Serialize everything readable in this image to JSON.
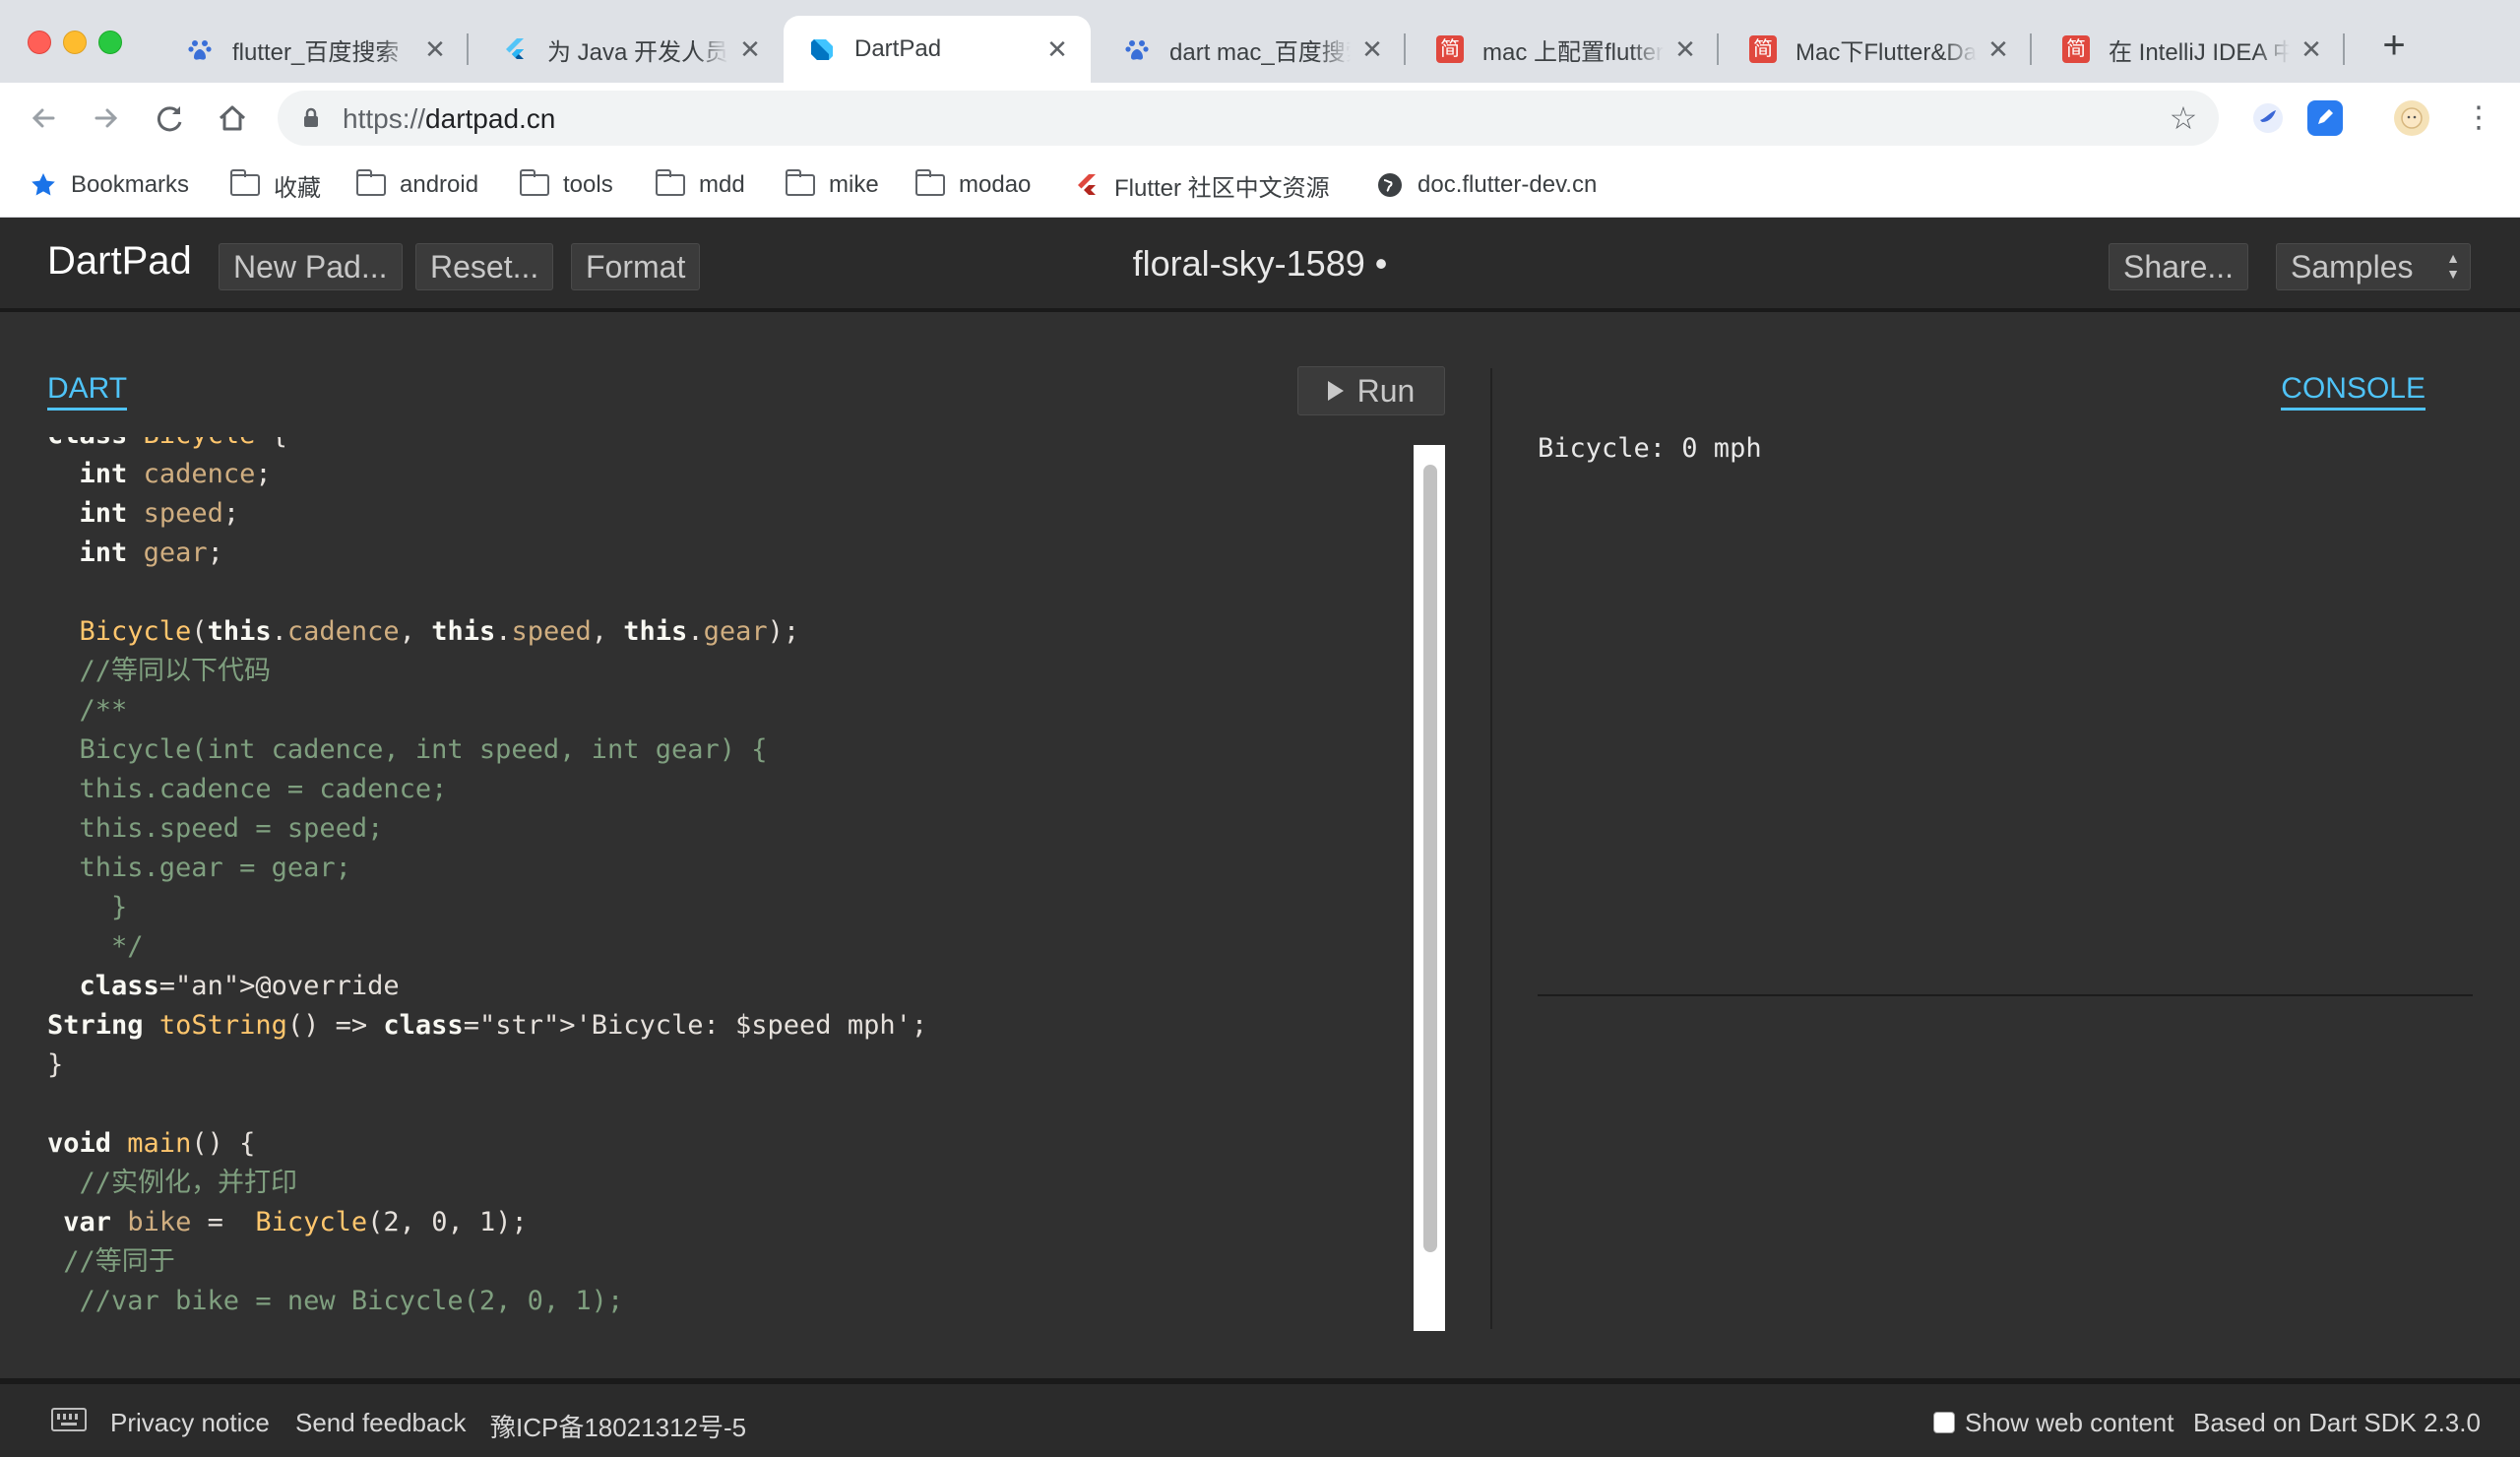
{
  "browser": {
    "tabs": [
      {
        "title": "flutter_百度搜索",
        "icon": "baidu-paw-icon",
        "active": false
      },
      {
        "title": "为 Java 开发人员准备的 Dart",
        "icon": "flutter-icon",
        "active": false
      },
      {
        "title": "DartPad",
        "icon": "dart-icon",
        "active": true
      },
      {
        "title": "dart mac_百度搜索",
        "icon": "baidu-paw-icon",
        "active": false
      },
      {
        "title": "mac 上配置flutter",
        "icon": "jianshu-icon",
        "active": false
      },
      {
        "title": "Mac下Flutter&Dart",
        "icon": "jianshu-icon",
        "active": false
      },
      {
        "title": "在 IntelliJ IDEA 中",
        "icon": "jianshu-icon",
        "active": false
      }
    ],
    "tab_close_glyph": "✕",
    "new_tab_glyph": "+",
    "jianshu_glyph": "简",
    "url_scheme": "https://",
    "url_host": "dartpad.cn",
    "bookmarks": [
      {
        "label": "Bookmarks",
        "icon": "star-icon"
      },
      {
        "label": "收藏",
        "icon": "folder-icon"
      },
      {
        "label": "android",
        "icon": "folder-icon"
      },
      {
        "label": "tools",
        "icon": "folder-icon"
      },
      {
        "label": "mdd",
        "icon": "folder-icon"
      },
      {
        "label": "mike",
        "icon": "folder-icon"
      },
      {
        "label": "modao",
        "icon": "folder-icon"
      },
      {
        "label": "Flutter 社区中文资源",
        "icon": "flutter-icon"
      },
      {
        "label": "doc.flutter-dev.cn",
        "icon": "globe-icon"
      }
    ]
  },
  "dartpad": {
    "brand": "DartPad",
    "new_pad": "New Pad...",
    "reset": "Reset...",
    "format": "Format",
    "pad_name": "floral-sky-1589 •",
    "share": "Share...",
    "samples": "Samples",
    "editor_tab": "DART",
    "run": "Run",
    "console_tab": "CONSOLE",
    "console_output": "Bicycle: 0 mph",
    "code_lines": [
      "class Bicycle {",
      "  int cadence;",
      "  int speed;",
      "  int gear;",
      "",
      "  Bicycle(this.cadence, this.speed, this.gear);",
      "  //等同以下代码",
      "  /**",
      "  Bicycle(int cadence, int speed, int gear) {",
      "  this.cadence = cadence;",
      "  this.speed = speed;",
      "  this.gear = gear;",
      "    }",
      "    */",
      "  @override",
      "String toString() => 'Bicycle: $speed mph';",
      "}",
      "",
      "void main() {",
      "  //实例化，并打印",
      " var bike =  Bicycle(2, 0, 1);",
      " //等同于",
      "  //var bike = new Bicycle(2, 0, 1);"
    ]
  },
  "footer": {
    "privacy": "Privacy notice",
    "feedback": "Send feedback",
    "icp": "豫ICP备18021312号-5",
    "show_web": "Show web content",
    "sdk": "Based on Dart SDK 2.3.0"
  },
  "colors": {
    "accent": "#4fc3f7",
    "editor_bg": "#303030",
    "header_bg": "#2b2b2b"
  }
}
